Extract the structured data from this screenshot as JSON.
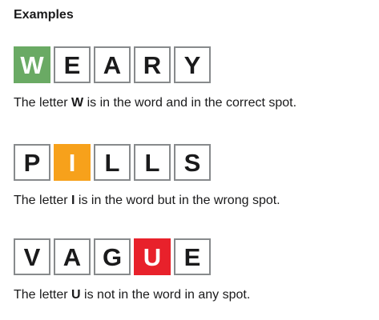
{
  "heading": "Examples",
  "colors": {
    "correct": "#6aaa64",
    "present": "#f7a11b",
    "absent": "#e8212b",
    "tile_border": "#878a8c"
  },
  "examples": [
    {
      "letters": [
        "W",
        "E",
        "A",
        "R",
        "Y"
      ],
      "highlight_index": 0,
      "highlight_state": "correct",
      "desc_prefix": "The letter ",
      "desc_letter": "W",
      "desc_suffix": " is in the word and in the correct spot."
    },
    {
      "letters": [
        "P",
        "I",
        "L",
        "L",
        "S"
      ],
      "highlight_index": 1,
      "highlight_state": "present",
      "desc_prefix": "The letter ",
      "desc_letter": "I",
      "desc_suffix": " is in the word but in the wrong spot."
    },
    {
      "letters": [
        "V",
        "A",
        "G",
        "U",
        "E"
      ],
      "highlight_index": 3,
      "highlight_state": "absent",
      "desc_prefix": "The letter ",
      "desc_letter": "U",
      "desc_suffix": " is not in the word in any spot."
    }
  ]
}
